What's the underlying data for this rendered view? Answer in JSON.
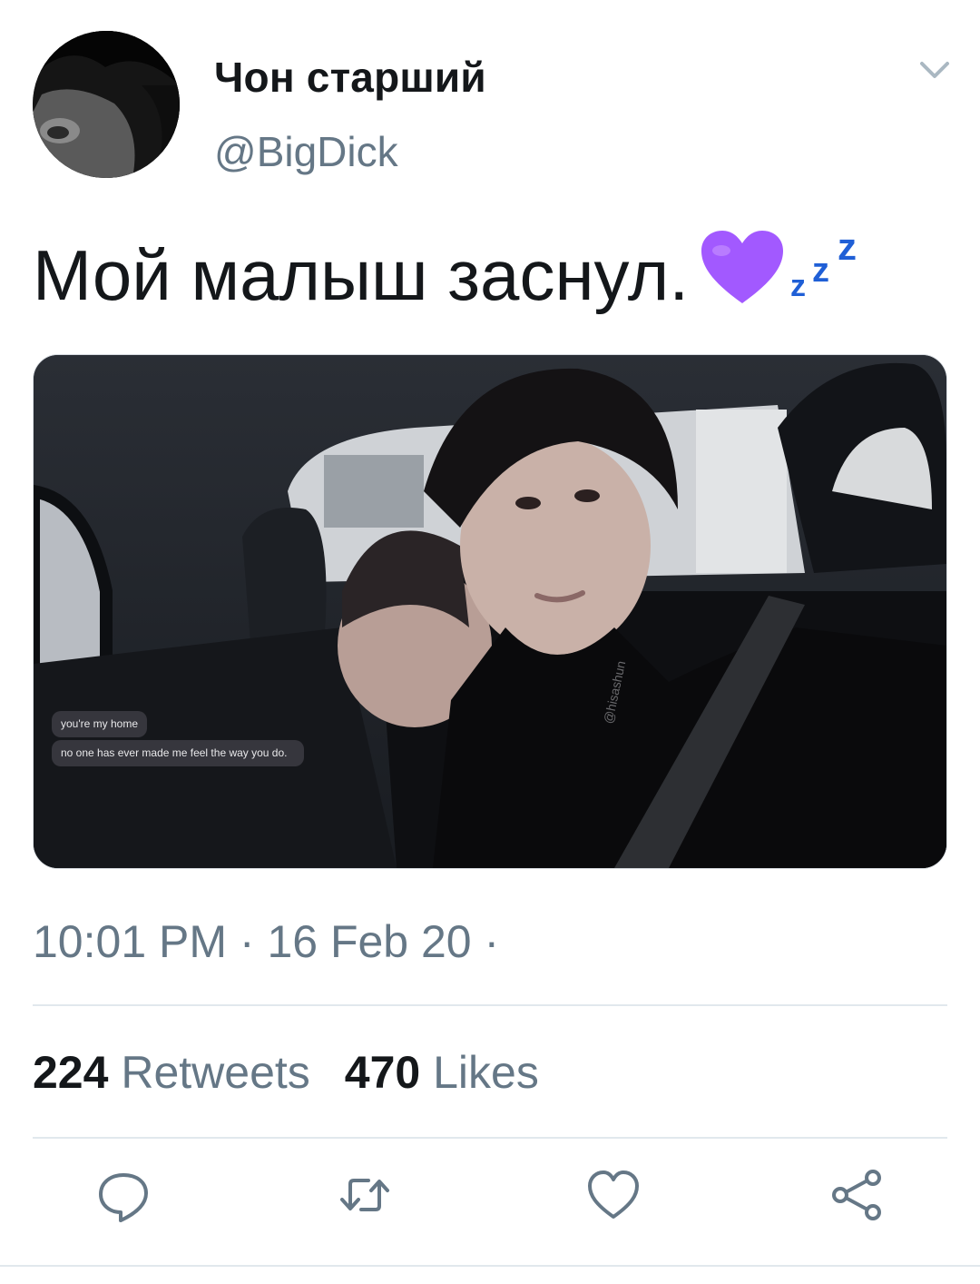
{
  "user": {
    "display_name": "Чон старший",
    "handle": "@BigDick"
  },
  "tweet": {
    "text": "Мой малыш заснул.",
    "emojis": [
      "purple-heart-icon",
      "zzz-icon"
    ],
    "media": {
      "captions": [
        "you're my home",
        "no one has ever made me feel the way you do."
      ],
      "watermark": "@hisashun"
    },
    "timestamp": "10:01 PM · 16 Feb 20 ·"
  },
  "stats": {
    "retweets_count": "224",
    "retweets_label": "Retweets",
    "likes_count": "470",
    "likes_label": "Likes"
  },
  "actions": [
    "reply-icon",
    "retweet-icon",
    "like-icon",
    "share-icon"
  ],
  "colors": {
    "secondary_text": "#657786",
    "heart": "#a259ff",
    "zzz": "#1f5fd6",
    "divider": "#e1e8ed"
  }
}
